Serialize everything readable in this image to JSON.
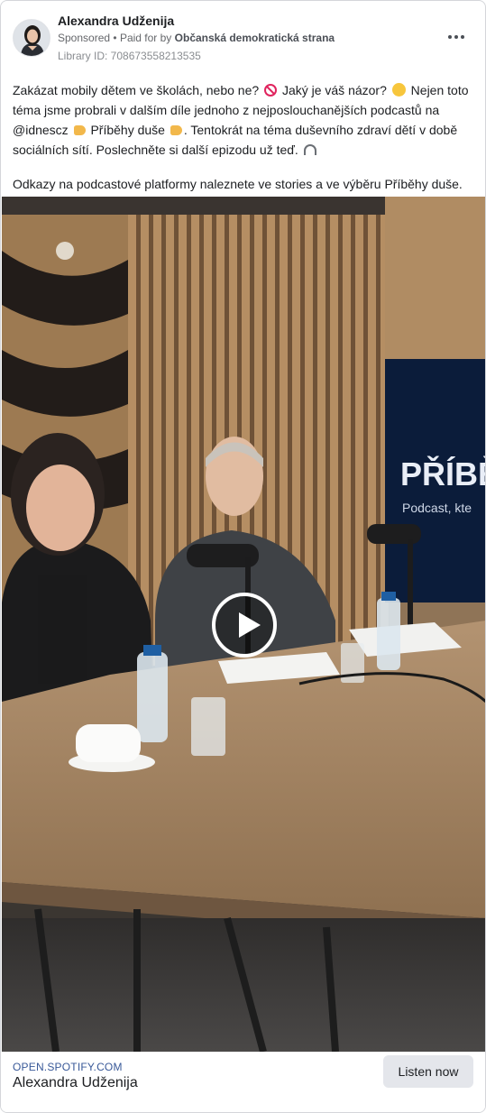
{
  "advertiser": {
    "name": "Alexandra Udženija",
    "sponsored_label": "Sponsored",
    "separator": "•",
    "paid_for_prefix": "Paid for by",
    "paid_for_by": "Občanská demokratická strana",
    "library_id": "Library ID: 708673558213535"
  },
  "more_icon": "more-horizontal-icon",
  "post": {
    "paragraph1": {
      "part1": "Zakázat mobily dětem ve školách, nebo ne?",
      "part2": "Jaký je váš názor?",
      "part3": "Nejen toto téma jsme probrali v dalším díle jednoho z nejposlouchanějších podcastů na @idnescz",
      "part4": "Příběhy duše",
      "part5": ". Tentokrát na téma duševního zdraví dětí v době sociálních sítí. Poslechněte si další epizodu už teď."
    },
    "paragraph2": "Odkazy na podcastové platformy naleznete ve stories a ve výběru Příběhy duše.",
    "emoji": [
      "no-entry-emoji",
      "thinking-face-emoji",
      "pointing-hand-emoji",
      "waving-hand-emoji",
      "headphones-emoji"
    ]
  },
  "media": {
    "screen_title": "PŘÍBĚ",
    "screen_subtitle": "Podcast, kte",
    "play_icon": "play-icon"
  },
  "link": {
    "domain": "OPEN.SPOTIFY.COM",
    "title": "Alexandra Udženija",
    "cta": "Listen now"
  },
  "colors": {
    "link_domain": "#385898",
    "cta_background": "#e4e6eb",
    "screen_background": "#0b1c3a"
  }
}
